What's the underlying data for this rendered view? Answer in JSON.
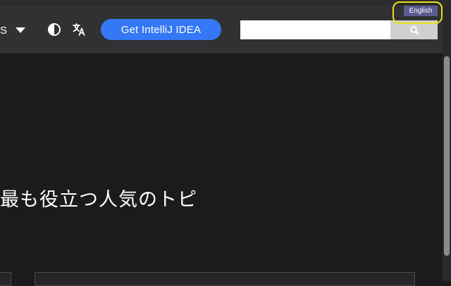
{
  "header": {
    "nav_menu_label": "S",
    "cta_label": "Get IntelliJ IDEA",
    "search": {
      "value": "",
      "placeholder": ""
    },
    "language_badge": "English"
  },
  "hero": {
    "heading": "最も役立つ人気のトピ"
  },
  "icons": {
    "theme": "contrast-icon",
    "translate": "translate-icon",
    "search": "search-icon",
    "nav_caret": "chevron-down-icon"
  },
  "colors": {
    "page_bg": "#1b1b1d",
    "header_bg": "#313133",
    "cta": "#3478f6",
    "badge": "#5b5b8f",
    "highlight": "#e8e410"
  }
}
